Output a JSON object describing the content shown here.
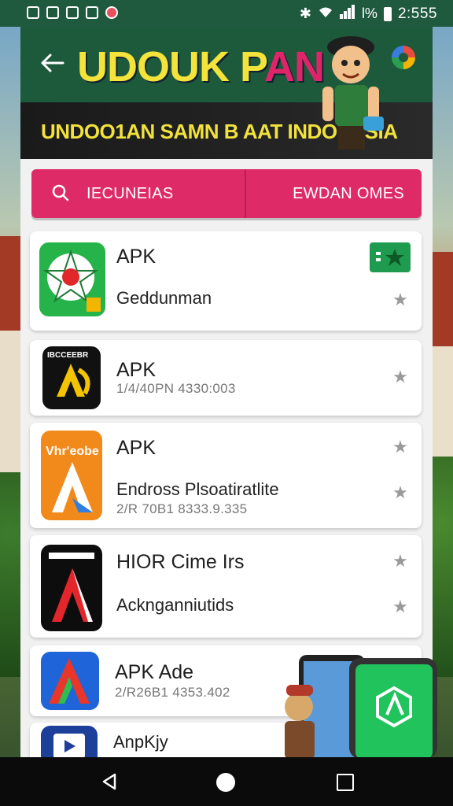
{
  "status_bar": {
    "time": "2:555",
    "battery_text": "l%"
  },
  "header": {
    "title_main": "UDOUK P",
    "title_accent": "AN",
    "subtitle": "UNDOO1AN SAMN B AAT INDONESIA"
  },
  "tabs": {
    "left_label": "IECUNEIAS",
    "right_label": "EWDAN OMES"
  },
  "list": [
    {
      "title": "APK",
      "subtitle": "Geddunman",
      "meta": ""
    },
    {
      "title": "APK",
      "subtitle": "",
      "meta": "1/4/40PN 4330:003",
      "icon_text": "IBCCEEBR"
    },
    {
      "title": "APK",
      "subtitle": "Endross Plsoatiratlite",
      "meta": "2/R 70B1 8333.9.335",
      "icon_text": "Vhr'eobe"
    },
    {
      "title": "HIOR Cime Irs",
      "subtitle": "Acknganniutids",
      "meta": ""
    },
    {
      "title": "APK Ade",
      "subtitle": "",
      "meta": "2/R26B1 4353.402"
    },
    {
      "title": "AnpKjy",
      "subtitle": "",
      "meta": ""
    }
  ],
  "colors": {
    "header_bg": "#1d5a3c",
    "tab_pink": "#de2b68",
    "title_yellow": "#f3e33b",
    "promo_green": "#20c35c"
  },
  "icons": {
    "back": "arrow-left-icon",
    "search": "search-icon",
    "star": "star-icon",
    "nav_back": "triangle-back-icon",
    "nav_home": "circle-home-icon",
    "nav_recent": "square-recent-icon"
  }
}
